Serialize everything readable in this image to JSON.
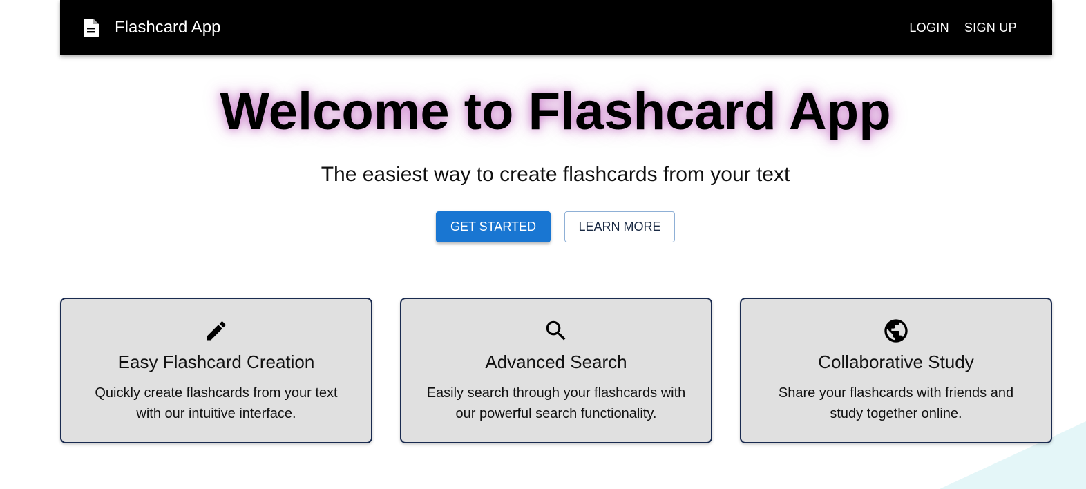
{
  "header": {
    "logo_icon": "document-icon",
    "brand": "Flashcard App",
    "nav": [
      {
        "label": "LOGIN"
      },
      {
        "label": "SIGN UP"
      }
    ]
  },
  "hero": {
    "title": "Welcome to Flashcard App",
    "subtitle": "The easiest way to create flashcards from your text",
    "primary_button": "GET STARTED",
    "secondary_button": "LEARN MORE"
  },
  "features": [
    {
      "icon": "pencil-icon",
      "title": "Easy Flashcard Creation",
      "description": "Quickly create flashcards from your text with our intuitive interface."
    },
    {
      "icon": "search-icon",
      "title": "Advanced Search",
      "description": "Easily search through your flashcards with our powerful search functionality."
    },
    {
      "icon": "globe-icon",
      "title": "Collaborative Study",
      "description": "Share your flashcards with friends and study together online."
    }
  ],
  "colors": {
    "appbar": "#000000",
    "primary": "#1976d2",
    "card_bg": "#e0e0e0",
    "card_border": "#1a2b50",
    "title_glow": "#a828a8"
  }
}
